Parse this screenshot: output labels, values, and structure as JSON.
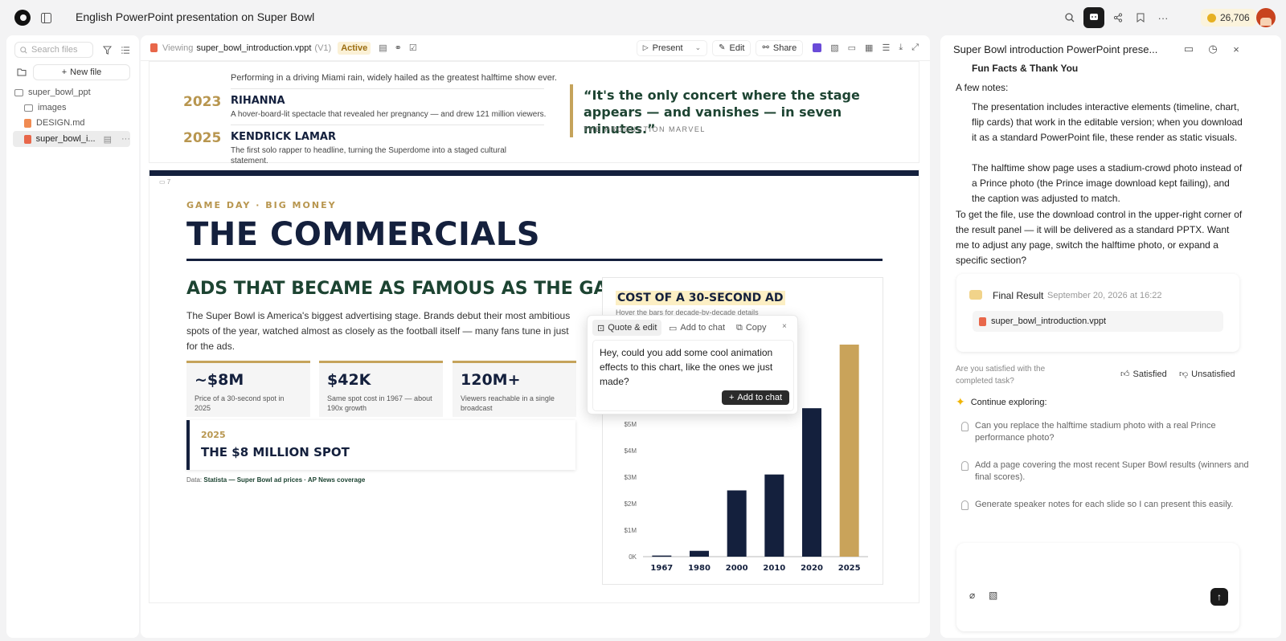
{
  "topbar": {
    "title": "English PowerPoint presentation on Super Bowl",
    "credits": "26,706"
  },
  "sidebar": {
    "search_placeholder": "Search files",
    "new_file": "New file",
    "tree": [
      {
        "label": "super_bowl_ppt",
        "kind": "folder"
      },
      {
        "label": "images",
        "kind": "folder"
      },
      {
        "label": "DESIGN.md",
        "kind": "md"
      },
      {
        "label": "super_bowl_i...",
        "kind": "ppt"
      }
    ]
  },
  "viewer": {
    "viewing_label": "Viewing",
    "filename": "super_bowl_introduction.vppt",
    "version": "(V1)",
    "status": "Active",
    "present": "Present",
    "edit": "Edit",
    "share": "Share"
  },
  "slide6": {
    "rain_text": "Performing in a driving Miami rain, widely hailed as the greatest halftime show ever.",
    "items": [
      {
        "year": "2023",
        "name": "RIHANNA",
        "desc": "A hover-board-lit spectacle that revealed her pregnancy — and drew 121 million viewers."
      },
      {
        "year": "2025",
        "name": "KENDRICK LAMAR",
        "desc": "The first solo rapper to headline, turning the Superdome into a staged cultural statement."
      }
    ],
    "quote": "“It's the only concert where the stage appears — and vanishes — in seven minutes.”",
    "quote_source": "THE PRODUCTION MARVEL"
  },
  "slide7": {
    "page_number": "7",
    "kicker": "GAME DAY · BIG MONEY",
    "title": "THE COMMERCIALS",
    "headline": "ADS THAT BECAME AS FAMOUS AS THE GAME",
    "body": "The Super Bowl is America's biggest advertising stage. Brands debut their most ambitious spots of the year, watched almost as closely as the football itself — many fans tune in just for the ads.",
    "stats": [
      {
        "value": "~$8M",
        "label": "Price of a 30-second spot in 2025"
      },
      {
        "value": "$42K",
        "label": "Same spot cost in 1967 — about 190x growth"
      },
      {
        "value": "120M+",
        "label": "Viewers reachable in a single broadcast"
      }
    ],
    "highlight_year": "2025",
    "highlight_title": "THE $8 MILLION SPOT",
    "source_prefix": "Data:",
    "source": "Statista — Super Bowl ad prices · AP News coverage",
    "chart_subtitle": "Hover the bars for decade-by-decade details"
  },
  "chart_data": {
    "type": "bar",
    "title": "COST OF A 30-SECOND AD",
    "categories": [
      "1967",
      "1980",
      "2000",
      "2010",
      "2020",
      "2025"
    ],
    "values": [
      0.042,
      0.22,
      2.5,
      3.1,
      5.6,
      8.0
    ],
    "y_ticks": [
      "0K",
      "$1M",
      "$2M",
      "$3M",
      "$4M",
      "$5M"
    ],
    "ylim": [
      0,
      8.0
    ],
    "colors": {
      "bar": "#14203d",
      "highlight": "#c9a35a"
    },
    "highlight_category": "2025"
  },
  "popup": {
    "quote_edit": "Quote & edit",
    "add_chat": "Add to chat",
    "copy": "Copy",
    "message": "Hey, could you add some cool animation effects to this chart, like the ones we just made?",
    "submit": "Add to chat"
  },
  "right": {
    "title": "Super Bowl introduction PowerPoint prese...",
    "heading": "Fun Facts & Thank You",
    "notes_intro": "A few notes:",
    "notes": [
      "The presentation includes interactive elements (timeline, chart, flip cards) that work in the editable version; when you download it as a standard PowerPoint file, these render as static visuals.",
      "The halftime show page uses a stadium-crowd photo instead of a Prince photo (the Prince image download kept failing), and the caption was adjusted to match."
    ],
    "closing": "To get the file, use the download control in the upper-right corner of the result panel — it will be delivered as a standard PPTX. Want me to adjust any page, switch the halftime photo, or expand a specific section?",
    "result_label": "Final Result",
    "result_date": "September 20, 2026 at 16:22",
    "result_file": "super_bowl_introduction.vppt",
    "satisfied_q": "Are you satisfied with the completed task?",
    "satisfied": "Satisfied",
    "unsatisfied": "Unsatisfied",
    "continue": "Continue exploring:",
    "suggestions": [
      "Can you replace the halftime stadium photo with a real Prince performance photo?",
      "Add a page covering the most recent Super Bowl results (winners and final scores).",
      "Generate speaker notes for each slide so I can present this easily."
    ]
  }
}
